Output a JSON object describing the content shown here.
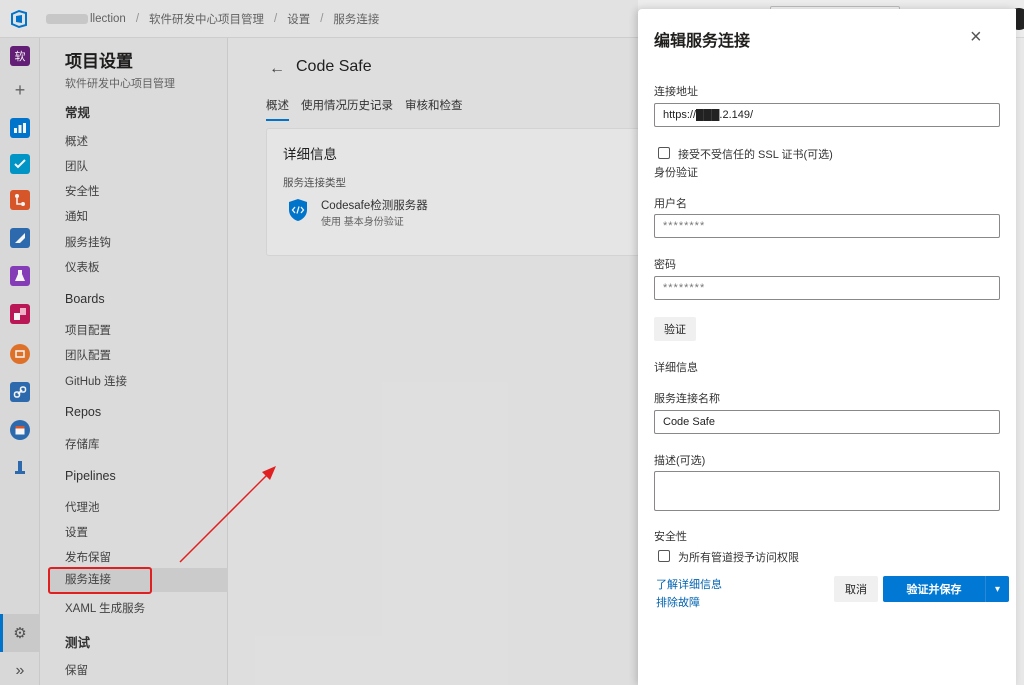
{
  "header": {
    "breadcrumbs": [
      "llection",
      "软件研发中心项目管理",
      "设置",
      "服务连接"
    ]
  },
  "rail": {
    "avatar_letter": "软",
    "plus": "+",
    "expand": "»"
  },
  "nav": {
    "title": "项目设置",
    "subtitle": "软件研发中心项目管理",
    "general_section": "常规",
    "general_items": [
      "概述",
      "团队",
      "安全性",
      "通知",
      "服务挂钩",
      "仪表板"
    ],
    "boards_section": "Boards",
    "boards_items": [
      "项目配置",
      "团队配置",
      "GitHub 连接"
    ],
    "repos_section": "Repos",
    "repos_items": [
      "存储库"
    ],
    "pipelines_section": "Pipelines",
    "pipelines_items": [
      "代理池",
      "设置",
      "发布保留",
      "服务连接",
      "XAML 生成服务"
    ],
    "test_section": "测试",
    "test_items": [
      "保留"
    ]
  },
  "main": {
    "back_glyph": "←",
    "title": "Code Safe",
    "tabs": [
      "概述",
      "使用情况历史记录",
      "审核和检查"
    ],
    "card": {
      "title": "详细信息",
      "type_label": "服务连接类型",
      "type_name": "Codesafe检测服务器",
      "type_desc": "使用 基本身份验证"
    }
  },
  "panel": {
    "title": "编辑服务连接",
    "close_glyph": "×",
    "url_label": "连接地址",
    "url_value": "https://███.2.149/",
    "ssl_checkbox": "接受不受信任的 SSL 证书(可选)",
    "auth_section": "身份验证",
    "username_label": "用户名",
    "username_placeholder": "********",
    "password_label": "密码",
    "password_placeholder": "********",
    "verify_button": "验证",
    "details_section": "详细信息",
    "name_label": "服务连接名称",
    "name_value": "Code Safe",
    "desc_label": "描述(可选)",
    "desc_value": "",
    "security_section": "安全性",
    "grant_checkbox": "为所有管道授予访问权限",
    "learn_more": "了解详细信息",
    "troubleshoot": "排除故障",
    "cancel_button": "取消",
    "save_button": "验证并保存",
    "dropdown_glyph": "▾"
  },
  "colors": {
    "accent": "#0078d4",
    "annotation": "#e02020"
  }
}
